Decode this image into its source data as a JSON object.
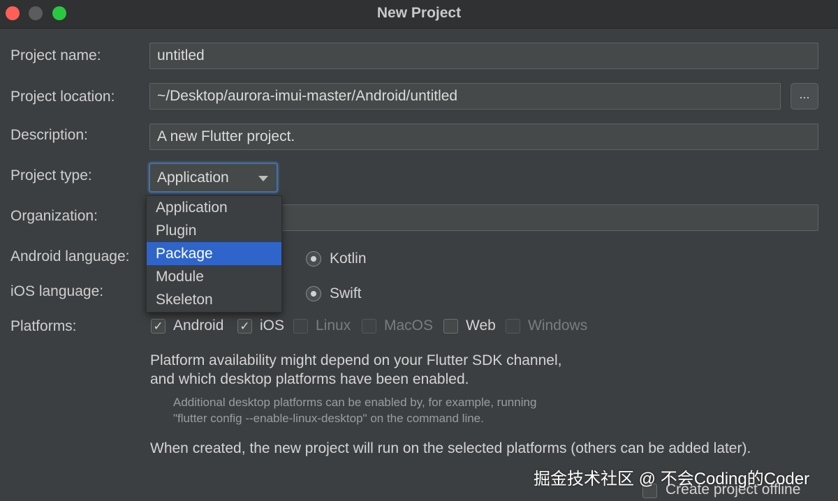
{
  "window": {
    "title": "New Project"
  },
  "form": {
    "project_name": {
      "label": "Project name:",
      "value": "untitled"
    },
    "project_location": {
      "label": "Project location:",
      "value": "~/Desktop/aurora-imui-master/Android/untitled",
      "browse_label": "..."
    },
    "description": {
      "label": "Description:",
      "value": "A new Flutter project."
    },
    "project_type": {
      "label": "Project type:",
      "value": "Application",
      "options": [
        "Application",
        "Plugin",
        "Package",
        "Module",
        "Skeleton"
      ],
      "highlighted": "Package"
    },
    "organization": {
      "label": "Organization:",
      "value": ""
    },
    "android_language": {
      "label": "Android language:",
      "selected": "Kotlin"
    },
    "ios_language": {
      "label": "iOS language:",
      "selected": "Swift"
    },
    "platforms": {
      "label": "Platforms:",
      "items": [
        {
          "name": "Android",
          "checked": true
        },
        {
          "name": "iOS",
          "checked": true
        },
        {
          "name": "Linux",
          "checked": false
        },
        {
          "name": "MacOS",
          "checked": false
        },
        {
          "name": "Web",
          "checked": false
        },
        {
          "name": "Windows",
          "checked": false
        }
      ]
    }
  },
  "notes": {
    "availability_line1": "Platform availability might depend on your Flutter SDK channel,",
    "availability_line2": "and which desktop platforms have been enabled.",
    "desktop_line1": "Additional desktop platforms can be enabled by, for example, running",
    "desktop_line2": "\"flutter config --enable-linux-desktop\" on the command line.",
    "created": "When created, the new project will run on the selected platforms (others can be added later)."
  },
  "offline": {
    "label": "Create project offline",
    "checked": false
  },
  "watermark": "掘金技术社区 @ 不会Coding的Coder",
  "colors": {
    "background": "#3c3f41",
    "selection": "#2f65ca",
    "focus": "#3d74b6"
  }
}
